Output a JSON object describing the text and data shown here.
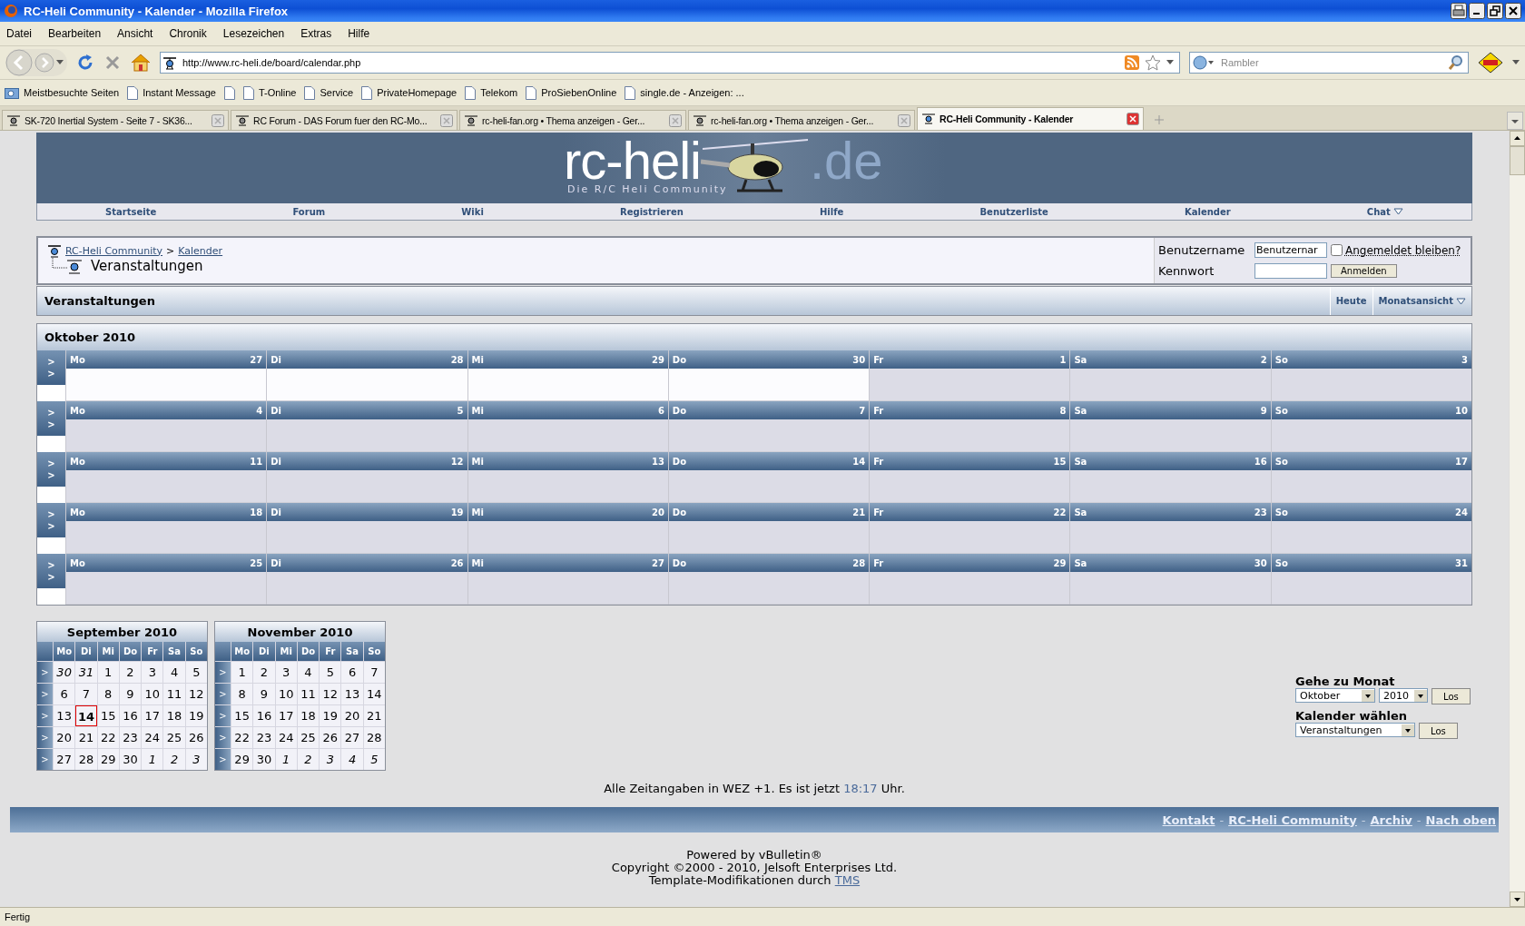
{
  "window": {
    "title": "RC-Heli Community - Kalender - Mozilla Firefox"
  },
  "menu": [
    "Datei",
    "Bearbeiten",
    "Ansicht",
    "Chronik",
    "Lesezeichen",
    "Extras",
    "Hilfe"
  ],
  "address": {
    "value": "http://www.rc-heli.de/board/calendar.php"
  },
  "search": {
    "placeholder": "Rambler"
  },
  "bookmarks": [
    {
      "kind": "folder",
      "label": "Meistbesuchte Seiten"
    },
    {
      "kind": "page",
      "label": "Instant Message"
    },
    {
      "kind": "page"
    },
    {
      "kind": "page",
      "label": "T-Online"
    },
    {
      "kind": "page",
      "label": "Service"
    },
    {
      "kind": "page",
      "label": "PrivateHomepage"
    },
    {
      "kind": "page",
      "label": "Telekom"
    },
    {
      "kind": "page",
      "label": "ProSiebenOnline"
    },
    {
      "kind": "page",
      "label": "single.de - Anzeigen: ..."
    }
  ],
  "tabs": [
    {
      "label": "SK-720 Inertial System - Seite 7 - SK36...",
      "selected": false
    },
    {
      "label": "RC Forum - DAS Forum fuer den RC-Mo...",
      "selected": false
    },
    {
      "label": "rc-heli-fan.org • Thema anzeigen - Ger...",
      "selected": false
    },
    {
      "label": "rc-heli-fan.org • Thema anzeigen - Ger...",
      "selected": false
    },
    {
      "label": "RC-Heli Community - Kalender",
      "selected": true
    }
  ],
  "site": {
    "logo": {
      "left": "rc-heli",
      "right": ".de",
      "tagline": "Die R/C Heli Community"
    },
    "nav": [
      {
        "label": "Startseite",
        "dropdown": false
      },
      {
        "label": "Forum",
        "dropdown": false
      },
      {
        "label": "Wiki",
        "dropdown": false
      },
      {
        "label": "Registrieren",
        "dropdown": false
      },
      {
        "label": "Hilfe",
        "dropdown": false
      },
      {
        "label": "Benutzerliste",
        "dropdown": false
      },
      {
        "label": "Kalender",
        "dropdown": false
      },
      {
        "label": "Chat",
        "dropdown": true
      }
    ]
  },
  "breadcrumb": {
    "links": [
      "RC-Heli Community",
      "Kalender"
    ],
    "separator": ">",
    "title": "Veranstaltungen"
  },
  "login": {
    "username_label": "Benutzername",
    "username_value": "Benutzernar",
    "password_label": "Kennwort",
    "remember_label": "Angemeldet bleiben?",
    "remember_checked": false,
    "submit": "Anmelden"
  },
  "toolbar": {
    "title": "Veranstaltungen",
    "links": [
      {
        "label": "Heute",
        "dropdown": false
      },
      {
        "label": "Monatsansicht",
        "dropdown": true
      }
    ]
  },
  "month": {
    "title": "Oktober 2010",
    "weeks": [
      {
        "arrows": [
          ">",
          ">"
        ],
        "days": [
          {
            "weekday": "Mo",
            "day": "27",
            "other_month": true
          },
          {
            "weekday": "Di",
            "day": "28",
            "other_month": true
          },
          {
            "weekday": "Mi",
            "day": "29",
            "other_month": true
          },
          {
            "weekday": "Do",
            "day": "30",
            "other_month": true
          },
          {
            "weekday": "Fr",
            "day": "1",
            "other_month": false
          },
          {
            "weekday": "Sa",
            "day": "2",
            "other_month": false
          },
          {
            "weekday": "So",
            "day": "3",
            "other_month": false
          }
        ]
      },
      {
        "arrows": [
          ">",
          ">"
        ],
        "days": [
          {
            "weekday": "Mo",
            "day": "4",
            "other_month": false
          },
          {
            "weekday": "Di",
            "day": "5",
            "other_month": false
          },
          {
            "weekday": "Mi",
            "day": "6",
            "other_month": false
          },
          {
            "weekday": "Do",
            "day": "7",
            "other_month": false
          },
          {
            "weekday": "Fr",
            "day": "8",
            "other_month": false
          },
          {
            "weekday": "Sa",
            "day": "9",
            "other_month": false
          },
          {
            "weekday": "So",
            "day": "10",
            "other_month": false
          }
        ]
      },
      {
        "arrows": [
          ">",
          ">"
        ],
        "days": [
          {
            "weekday": "Mo",
            "day": "11",
            "other_month": false
          },
          {
            "weekday": "Di",
            "day": "12",
            "other_month": false
          },
          {
            "weekday": "Mi",
            "day": "13",
            "other_month": false
          },
          {
            "weekday": "Do",
            "day": "14",
            "other_month": false
          },
          {
            "weekday": "Fr",
            "day": "15",
            "other_month": false
          },
          {
            "weekday": "Sa",
            "day": "16",
            "other_month": false
          },
          {
            "weekday": "So",
            "day": "17",
            "other_month": false
          }
        ]
      },
      {
        "arrows": [
          ">",
          ">"
        ],
        "days": [
          {
            "weekday": "Mo",
            "day": "18",
            "other_month": false
          },
          {
            "weekday": "Di",
            "day": "19",
            "other_month": false
          },
          {
            "weekday": "Mi",
            "day": "20",
            "other_month": false
          },
          {
            "weekday": "Do",
            "day": "21",
            "other_month": false
          },
          {
            "weekday": "Fr",
            "day": "22",
            "other_month": false
          },
          {
            "weekday": "Sa",
            "day": "23",
            "other_month": false
          },
          {
            "weekday": "So",
            "day": "24",
            "other_month": false
          }
        ]
      },
      {
        "arrows": [
          ">",
          ">"
        ],
        "days": [
          {
            "weekday": "Mo",
            "day": "25",
            "other_month": false
          },
          {
            "weekday": "Di",
            "day": "26",
            "other_month": false
          },
          {
            "weekday": "Mi",
            "day": "27",
            "other_month": false
          },
          {
            "weekday": "Do",
            "day": "28",
            "other_month": false
          },
          {
            "weekday": "Fr",
            "day": "29",
            "other_month": false
          },
          {
            "weekday": "Sa",
            "day": "30",
            "other_month": false
          },
          {
            "weekday": "So",
            "day": "31",
            "other_month": false
          }
        ]
      }
    ]
  },
  "mini_calendars": [
    {
      "title": "September 2010",
      "weekdays": [
        "Mo",
        "Di",
        "Mi",
        "Do",
        "Fr",
        "Sa",
        "So"
      ],
      "weeks": [
        {
          "link": ">",
          "days": [
            {
              "day": "30",
              "other_month": true,
              "today": false
            },
            {
              "day": "31",
              "other_month": true,
              "today": false
            },
            {
              "day": "1",
              "other_month": false,
              "today": false
            },
            {
              "day": "2",
              "other_month": false,
              "today": false
            },
            {
              "day": "3",
              "other_month": false,
              "today": false
            },
            {
              "day": "4",
              "other_month": false,
              "today": false
            },
            {
              "day": "5",
              "other_month": false,
              "today": false
            }
          ]
        },
        {
          "link": ">",
          "days": [
            {
              "day": "6",
              "other_month": false,
              "today": false
            },
            {
              "day": "7",
              "other_month": false,
              "today": false
            },
            {
              "day": "8",
              "other_month": false,
              "today": false
            },
            {
              "day": "9",
              "other_month": false,
              "today": false
            },
            {
              "day": "10",
              "other_month": false,
              "today": false
            },
            {
              "day": "11",
              "other_month": false,
              "today": false
            },
            {
              "day": "12",
              "other_month": false,
              "today": false
            }
          ]
        },
        {
          "link": ">",
          "days": [
            {
              "day": "13",
              "other_month": false,
              "today": false
            },
            {
              "day": "14",
              "other_month": false,
              "today": true
            },
            {
              "day": "15",
              "other_month": false,
              "today": false
            },
            {
              "day": "16",
              "other_month": false,
              "today": false
            },
            {
              "day": "17",
              "other_month": false,
              "today": false
            },
            {
              "day": "18",
              "other_month": false,
              "today": false
            },
            {
              "day": "19",
              "other_month": false,
              "today": false
            }
          ]
        },
        {
          "link": ">",
          "days": [
            {
              "day": "20",
              "other_month": false,
              "today": false
            },
            {
              "day": "21",
              "other_month": false,
              "today": false
            },
            {
              "day": "22",
              "other_month": false,
              "today": false
            },
            {
              "day": "23",
              "other_month": false,
              "today": false
            },
            {
              "day": "24",
              "other_month": false,
              "today": false
            },
            {
              "day": "25",
              "other_month": false,
              "today": false
            },
            {
              "day": "26",
              "other_month": false,
              "today": false
            }
          ]
        },
        {
          "link": ">",
          "days": [
            {
              "day": "27",
              "other_month": false,
              "today": false
            },
            {
              "day": "28",
              "other_month": false,
              "today": false
            },
            {
              "day": "29",
              "other_month": false,
              "today": false
            },
            {
              "day": "30",
              "other_month": false,
              "today": false
            },
            {
              "day": "1",
              "other_month": true,
              "today": false
            },
            {
              "day": "2",
              "other_month": true,
              "today": false
            },
            {
              "day": "3",
              "other_month": true,
              "today": false
            }
          ]
        }
      ]
    },
    {
      "title": "November 2010",
      "weekdays": [
        "Mo",
        "Di",
        "Mi",
        "Do",
        "Fr",
        "Sa",
        "So"
      ],
      "weeks": [
        {
          "link": ">",
          "days": [
            {
              "day": "1",
              "other_month": false,
              "today": false
            },
            {
              "day": "2",
              "other_month": false,
              "today": false
            },
            {
              "day": "3",
              "other_month": false,
              "today": false
            },
            {
              "day": "4",
              "other_month": false,
              "today": false
            },
            {
              "day": "5",
              "other_month": false,
              "today": false
            },
            {
              "day": "6",
              "other_month": false,
              "today": false
            },
            {
              "day": "7",
              "other_month": false,
              "today": false
            }
          ]
        },
        {
          "link": ">",
          "days": [
            {
              "day": "8",
              "other_month": false,
              "today": false
            },
            {
              "day": "9",
              "other_month": false,
              "today": false
            },
            {
              "day": "10",
              "other_month": false,
              "today": false
            },
            {
              "day": "11",
              "other_month": false,
              "today": false
            },
            {
              "day": "12",
              "other_month": false,
              "today": false
            },
            {
              "day": "13",
              "other_month": false,
              "today": false
            },
            {
              "day": "14",
              "other_month": false,
              "today": false
            }
          ]
        },
        {
          "link": ">",
          "days": [
            {
              "day": "15",
              "other_month": false,
              "today": false
            },
            {
              "day": "16",
              "other_month": false,
              "today": false
            },
            {
              "day": "17",
              "other_month": false,
              "today": false
            },
            {
              "day": "18",
              "other_month": false,
              "today": false
            },
            {
              "day": "19",
              "other_month": false,
              "today": false
            },
            {
              "day": "20",
              "other_month": false,
              "today": false
            },
            {
              "day": "21",
              "other_month": false,
              "today": false
            }
          ]
        },
        {
          "link": ">",
          "days": [
            {
              "day": "22",
              "other_month": false,
              "today": false
            },
            {
              "day": "23",
              "other_month": false,
              "today": false
            },
            {
              "day": "24",
              "other_month": false,
              "today": false
            },
            {
              "day": "25",
              "other_month": false,
              "today": false
            },
            {
              "day": "26",
              "other_month": false,
              "today": false
            },
            {
              "day": "27",
              "other_month": false,
              "today": false
            },
            {
              "day": "28",
              "other_month": false,
              "today": false
            }
          ]
        },
        {
          "link": ">",
          "days": [
            {
              "day": "29",
              "other_month": false,
              "today": false
            },
            {
              "day": "30",
              "other_month": false,
              "today": false
            },
            {
              "day": "1",
              "other_month": true,
              "today": false
            },
            {
              "day": "2",
              "other_month": true,
              "today": false
            },
            {
              "day": "3",
              "other_month": true,
              "today": false
            },
            {
              "day": "4",
              "other_month": true,
              "today": false
            },
            {
              "day": "5",
              "other_month": true,
              "today": false
            }
          ]
        }
      ]
    }
  ],
  "goto_month": {
    "label": "Gehe zu Monat",
    "month": "Oktober",
    "year": "2010",
    "button": "Los"
  },
  "calendar_select": {
    "label": "Kalender wählen",
    "value": "Veranstaltungen",
    "button": "Los"
  },
  "timezone": {
    "text": "Alle Zeitangaben in WEZ +1. Es ist jetzt",
    "time": "18:17",
    "suffix": "Uhr."
  },
  "footer_links": {
    "links": [
      "Kontakt",
      "RC-Heli Community",
      "Archiv",
      "Nach oben"
    ],
    "separator": "-"
  },
  "powered": [
    "Powered by vBulletin®",
    "Copyright ©2000 - 2010, Jelsoft Enterprises Ltd."
  ],
  "template_credit": {
    "text": "Template-Modifikationen durch",
    "link": "TMS"
  },
  "status_bar": "Fertig"
}
